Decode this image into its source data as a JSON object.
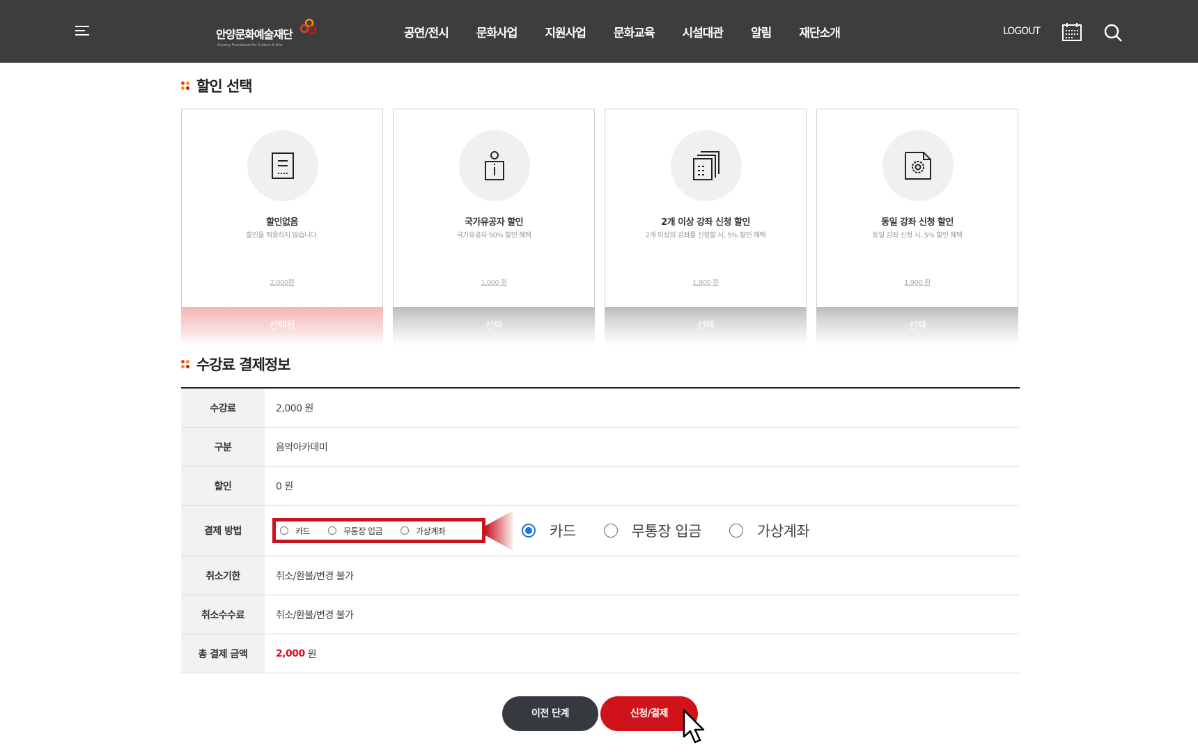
{
  "header": {
    "logo_text": "안양문화예술재단",
    "logo_sub": "Anyang Foundation for Culture & Arts",
    "nav": [
      "공연/전시",
      "문화사업",
      "지원사업",
      "문화교육",
      "시설대관",
      "알림",
      "재단소개"
    ],
    "logout": "LOGOUT"
  },
  "discount": {
    "title": "할인 선택",
    "cards": [
      {
        "title": "할인없음",
        "desc": "할인을 적용하지 않습니다.",
        "price": "2,000원",
        "button": "선택됨",
        "selected": true,
        "icon": "document-icon"
      },
      {
        "title": "국가유공자 할인",
        "desc": "국가유공자 50% 할인 혜택",
        "price": "1,000 원",
        "button": "선택",
        "selected": false,
        "icon": "person-info-icon"
      },
      {
        "title": "2개 이상 강좌 신청 할인",
        "desc": "2개 이상의 강좌를 신청할 시, 5% 할인 혜택",
        "price": "1,900 원",
        "button": "선택",
        "selected": false,
        "icon": "multi-document-icon"
      },
      {
        "title": "동일 강좌 신청 할인",
        "desc": "동일 강좌 신청 시, 5% 할인 혜택",
        "price": "1,900 원",
        "button": "선택",
        "selected": false,
        "icon": "gear-document-icon"
      }
    ]
  },
  "payment": {
    "title": "수강료 결제정보",
    "rows": {
      "fee": {
        "label": "수강료",
        "value": "2,000 원"
      },
      "category": {
        "label": "구분",
        "value": "음악아카데미"
      },
      "discount": {
        "label": "할인",
        "value": "0 원"
      },
      "method": {
        "label": "결제 방법",
        "options": [
          "카드",
          "무통장 입금",
          "가상계좌"
        ],
        "selected": "카드"
      },
      "cancel_deadline": {
        "label": "취소기한",
        "value": "취소/환불/변경 불가"
      },
      "cancel_fee": {
        "label": "취소수수료",
        "value": "취소/환불/변경 불가"
      },
      "total": {
        "label": "총 결제 금액",
        "amount": "2,000",
        "unit": "원"
      }
    }
  },
  "buttons": {
    "prev": "이전 단계",
    "apply": "신청/결제"
  },
  "colors": {
    "header_bg": "#3d3d3d",
    "accent_red": "#d0121b",
    "dark_button": "#363a3f",
    "radio_blue": "#1a73e8"
  }
}
